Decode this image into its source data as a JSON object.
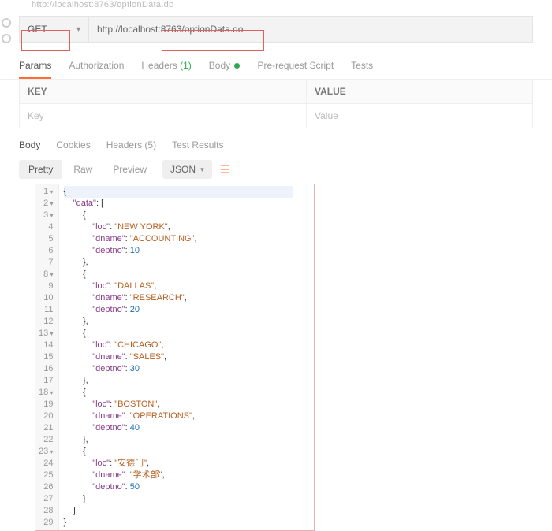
{
  "breadcrumb": "http://localhost:8763/optionData.do",
  "request": {
    "method": "GET",
    "url": "http://localhost:8763/optionData.do"
  },
  "req_tabs": {
    "params": "Params",
    "auth": "Authorization",
    "headers": "Headers",
    "headers_count": "(1)",
    "body": "Body",
    "prerequest": "Pre-request Script",
    "tests": "Tests"
  },
  "kv": {
    "key_hdr": "KEY",
    "val_hdr": "VALUE",
    "key_ph": "Key",
    "val_ph": "Value"
  },
  "resp_tabs": {
    "body": "Body",
    "cookies": "Cookies",
    "headers": "Headers",
    "headers_count": "(5)",
    "tests": "Test Results"
  },
  "toolbar": {
    "pretty": "Pretty",
    "raw": "Raw",
    "preview": "Preview",
    "format": "JSON"
  },
  "json_keys": {
    "data": "data",
    "loc": "loc",
    "dname": "dname",
    "deptno": "deptno"
  },
  "chart_data": {
    "type": "table",
    "title": "optionData.do response — data[]",
    "columns": [
      "loc",
      "dname",
      "deptno"
    ],
    "rows": [
      [
        "NEW YORK",
        "ACCOUNTING",
        10
      ],
      [
        "DALLAS",
        "RESEARCH",
        20
      ],
      [
        "CHICAGO",
        "SALES",
        30
      ],
      [
        "BOSTON",
        "OPERATIONS",
        40
      ],
      [
        "安德门",
        "学术部",
        50
      ]
    ]
  }
}
